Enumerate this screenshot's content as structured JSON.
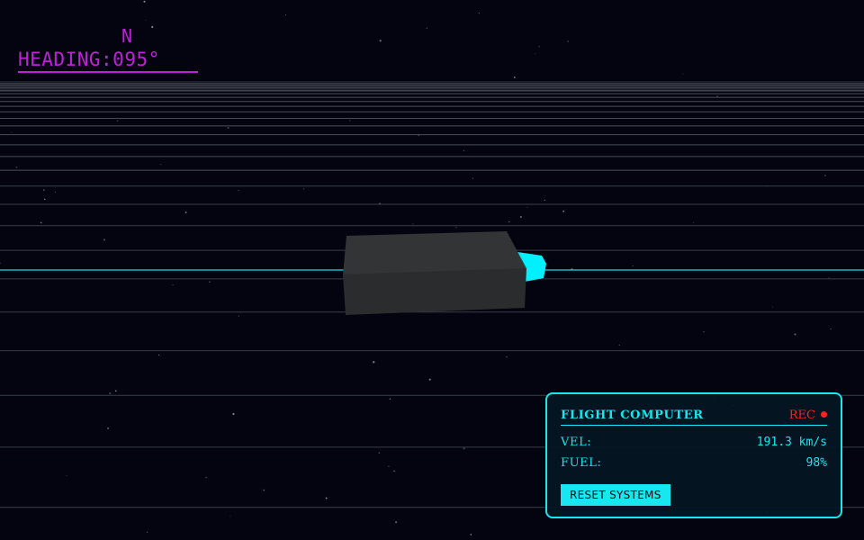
{
  "hud": {
    "compass_north": "N",
    "heading_label": "HEADING",
    "heading_value": "095°"
  },
  "panel": {
    "title": "FLIGHT COMPUTER",
    "rec_label": "REC",
    "velocity_label": "VEL:",
    "velocity_value": "191.3 km/s",
    "fuel_label": "FUEL:",
    "fuel_value": "98%",
    "reset_label": "RESET SYSTEMS"
  },
  "colors": {
    "accent": "#19e6f0",
    "compass": "#c020d8",
    "rec": "#ff2020",
    "background": "#03040f",
    "ship": "#333333"
  }
}
